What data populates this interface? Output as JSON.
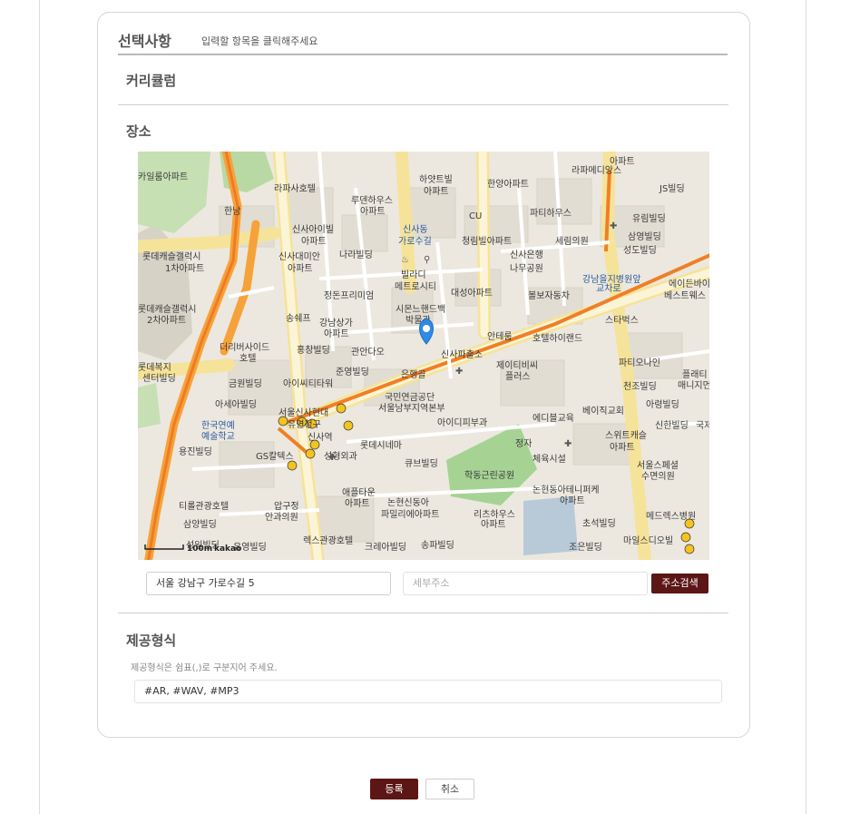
{
  "header": {
    "title": "선택사항",
    "subtitle": "입력할 항목을 클릭해주세요"
  },
  "sections": {
    "curriculum_label": "커리큘럼",
    "place_label": "장소",
    "format_label": "제공형식"
  },
  "map": {
    "provider_label": "kakao",
    "scale_label": "100m",
    "labels": [
      "라파메디앙스",
      "아파트",
      "하얏트빌",
      "아파트",
      "한양아파트",
      "카일룸아파트",
      "라파사호텔",
      "JS빌딩",
      "루덴하우스",
      "아파트",
      "CU",
      "파티하우스",
      "유림빌딩",
      "신사아이빌",
      "아파트",
      "신사동",
      "가로수길",
      "청림빌아파트",
      "세림의원",
      "삼영빌딩",
      "롯데캐슬갤럭시",
      "1차아파트",
      "나라빌딩",
      "신사은행",
      "나무공원",
      "성도빌딩",
      "신사대미안",
      "아파트",
      "빌라디",
      "메트로시티",
      "강남을지병원앞",
      "교차로",
      "에이든바이",
      "베스트웨스",
      "정돈프리미엄",
      "대성아파트",
      "볼보자동차",
      "롯데캐슬갤럭시",
      "2차아파트",
      "송쉐프",
      "시몬느핸드백",
      "박물관",
      "스타벅스",
      "강남상가",
      "아파트",
      "안테룸",
      "호텔하이랜드",
      "더리버사이드",
      "호텔",
      "홍창빌딩",
      "관안다오",
      "신사파출소",
      "파티오나인",
      "롯데복지",
      "센터빌딩",
      "준영빌딩",
      "은행골",
      "제이티비씨",
      "플러스",
      "플래티",
      "매니지먼",
      "금원빌딩",
      "아이씨티타워",
      "국민연금공단",
      "서울남부지역본부",
      "천조빌딩",
      "아세아빌딩",
      "서울신사현대",
      "유면청구",
      "아이디피부과",
      "에디블교육",
      "베이직교회",
      "아령빌딩",
      "신한빌딩",
      "한국연예",
      "예술학교",
      "롯데시네마",
      "스위트캐슬",
      "아파트",
      "용진빌딩",
      "GS칼텍스",
      "성형외과",
      "큐브빌딩",
      "체육시설",
      "서울스페셜",
      "수면의원",
      "학동근린공원",
      "논현동아테니퍼케",
      "아파트",
      "티롤관광호텔",
      "압구정",
      "안과의원",
      "애플타운",
      "아파트",
      "논현신동아",
      "파밀리에아파트",
      "리츠하우스",
      "아파트",
      "초석빌딩",
      "메드렉스병원",
      "삼양빌딩",
      "조은빌딩",
      "마일스디오빌",
      "성일빌딩",
      "유영빌딩",
      "렉스관광호텔",
      "크레아빌딩",
      "송파빌딩",
      "한남",
      "신사역",
      "정자",
      "국제"
    ]
  },
  "address": {
    "main_value": "서울 강남구 가로수길 5",
    "detail_placeholder": "세부주소",
    "search_button": "주소검색"
  },
  "format": {
    "hint": "제공형식은 쉼표(,)로 구분지어 주세요.",
    "value": "#AR, #WAV, #MP3"
  },
  "footer": {
    "submit_label": "등록",
    "cancel_label": "취소"
  },
  "colors": {
    "accent": "#5c1616",
    "map_marker": "#2f8ae6"
  }
}
